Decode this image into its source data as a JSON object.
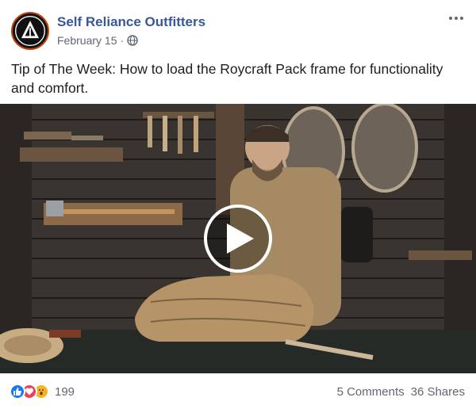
{
  "post": {
    "page_name": "Self Reliance Outfitters",
    "date": "February 15",
    "separator": "·",
    "visibility_icon": "globe-icon",
    "text": "Tip of The Week: How to load the Roycraft Pack frame for functionality and comfort."
  },
  "video": {
    "state": "paused",
    "overlay_icon": "play-icon"
  },
  "engagement": {
    "reaction_icons": [
      "like-icon",
      "love-icon",
      "wow-icon"
    ],
    "reaction_count": "199",
    "comments": "5 Comments",
    "shares": "36 Shares"
  },
  "colors": {
    "link": "#385898",
    "meta": "#606770",
    "like": "#1877f2",
    "love": "#f33e58",
    "wow": "#f7b125"
  }
}
